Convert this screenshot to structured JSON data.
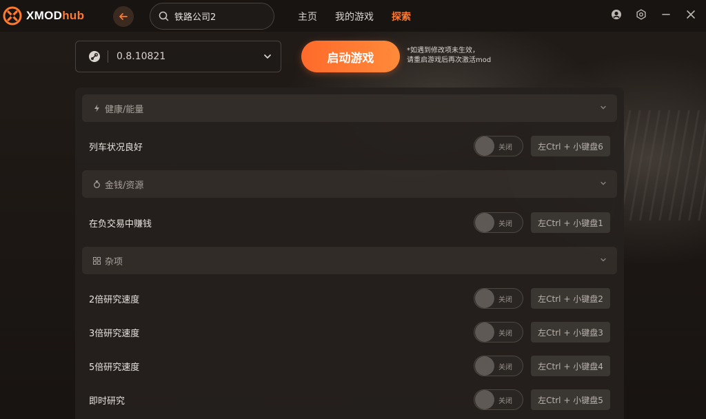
{
  "app": {
    "logo_white": "XMOD",
    "logo_orange": "hub"
  },
  "search": {
    "value": "铁路公司2"
  },
  "nav": [
    {
      "label": "主页",
      "active": false
    },
    {
      "label": "我的游戏",
      "active": false
    },
    {
      "label": "探索",
      "active": true
    }
  ],
  "colors": {
    "accent": "#ff7a2e",
    "background": "#1b1714",
    "panel": "#25211e"
  },
  "version": {
    "platform_icon": "steam-icon",
    "value": "0.8.10821"
  },
  "launch": {
    "label": "启动游戏",
    "note_line1": "*如遇到修改项未生效，",
    "note_line2": "请重启游戏后再次激活mod"
  },
  "sections": [
    {
      "title": "健康/能量",
      "icon": "lightning-icon",
      "items": [
        {
          "label": "列车状况良好",
          "toggle": "关闭",
          "on": false,
          "hotkey": "左Ctrl + 小键盘6"
        }
      ]
    },
    {
      "title": "金钱/资源",
      "icon": "money-bag-icon",
      "items": [
        {
          "label": "在负交易中赚钱",
          "toggle": "关闭",
          "on": false,
          "hotkey": "左Ctrl + 小键盘1"
        }
      ]
    },
    {
      "title": "杂项",
      "icon": "grid-icon",
      "items": [
        {
          "label": "2倍研究速度",
          "toggle": "关闭",
          "on": false,
          "hotkey": "左Ctrl + 小键盘2"
        },
        {
          "label": "3倍研究速度",
          "toggle": "关闭",
          "on": false,
          "hotkey": "左Ctrl + 小键盘3"
        },
        {
          "label": "5倍研究速度",
          "toggle": "关闭",
          "on": false,
          "hotkey": "左Ctrl + 小键盘4"
        },
        {
          "label": "即时研究",
          "toggle": "关闭",
          "on": false,
          "hotkey": "左Ctrl + 小键盘5"
        }
      ]
    }
  ]
}
